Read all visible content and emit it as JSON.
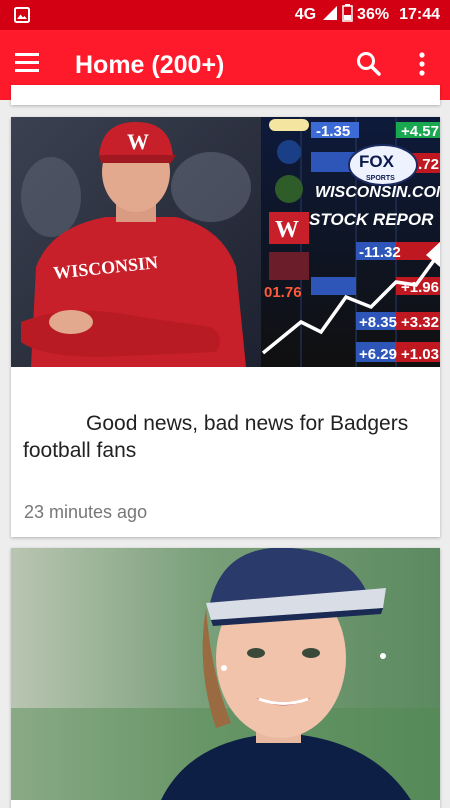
{
  "status_bar": {
    "network": "4G",
    "battery": "36%",
    "time": "17:44"
  },
  "app_bar": {
    "title": "Home (200+)"
  },
  "colors": {
    "status_bar": "#d30013",
    "app_bar": "#ff1a2b",
    "background": "#ededed"
  },
  "feed": {
    "articles": [
      {
        "image_logos": [
          "FOX SPORTS",
          "WISCONSIN.COM",
          "STOCK REPOR"
        ],
        "image_shirt_text": "WISCONSIN",
        "image_tickers": [
          "-1.35",
          "+4.57",
          "+2.72",
          "-11.32",
          "+1.96",
          "+8.35",
          "+3.32",
          "+6.29",
          "+1.03",
          "01.76"
        ],
        "headline": "Good news, bad news for Badgers football fans",
        "timestamp": "23 minutes ago"
      },
      {
        "image_icon": "golfer-portrait"
      }
    ]
  }
}
